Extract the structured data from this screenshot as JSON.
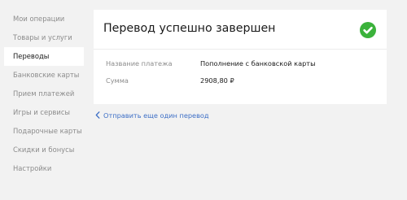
{
  "sidebar": {
    "items": [
      {
        "label": "Мои операции"
      },
      {
        "label": "Товары и услуги"
      },
      {
        "label": "Переводы"
      },
      {
        "label": "Банковские карты"
      },
      {
        "label": "Прием платежей"
      },
      {
        "label": "Игры и сервисы"
      },
      {
        "label": "Подарочные карты"
      },
      {
        "label": "Скидки и бонусы"
      },
      {
        "label": "Настройки"
      }
    ],
    "active_label": "Переводы"
  },
  "result": {
    "title": "Перевод успешно завершен",
    "status_icon": "check-circle-icon",
    "status_color": "#3bb23b",
    "fields": [
      {
        "label": "Название платежа",
        "value": "Пополнение с банковской карты"
      },
      {
        "label": "Сумма",
        "value": "2908,80 ₽"
      }
    ]
  },
  "actions": {
    "repeat_link": "Отправить еще один перевод",
    "link_color": "#3d6fc6"
  }
}
